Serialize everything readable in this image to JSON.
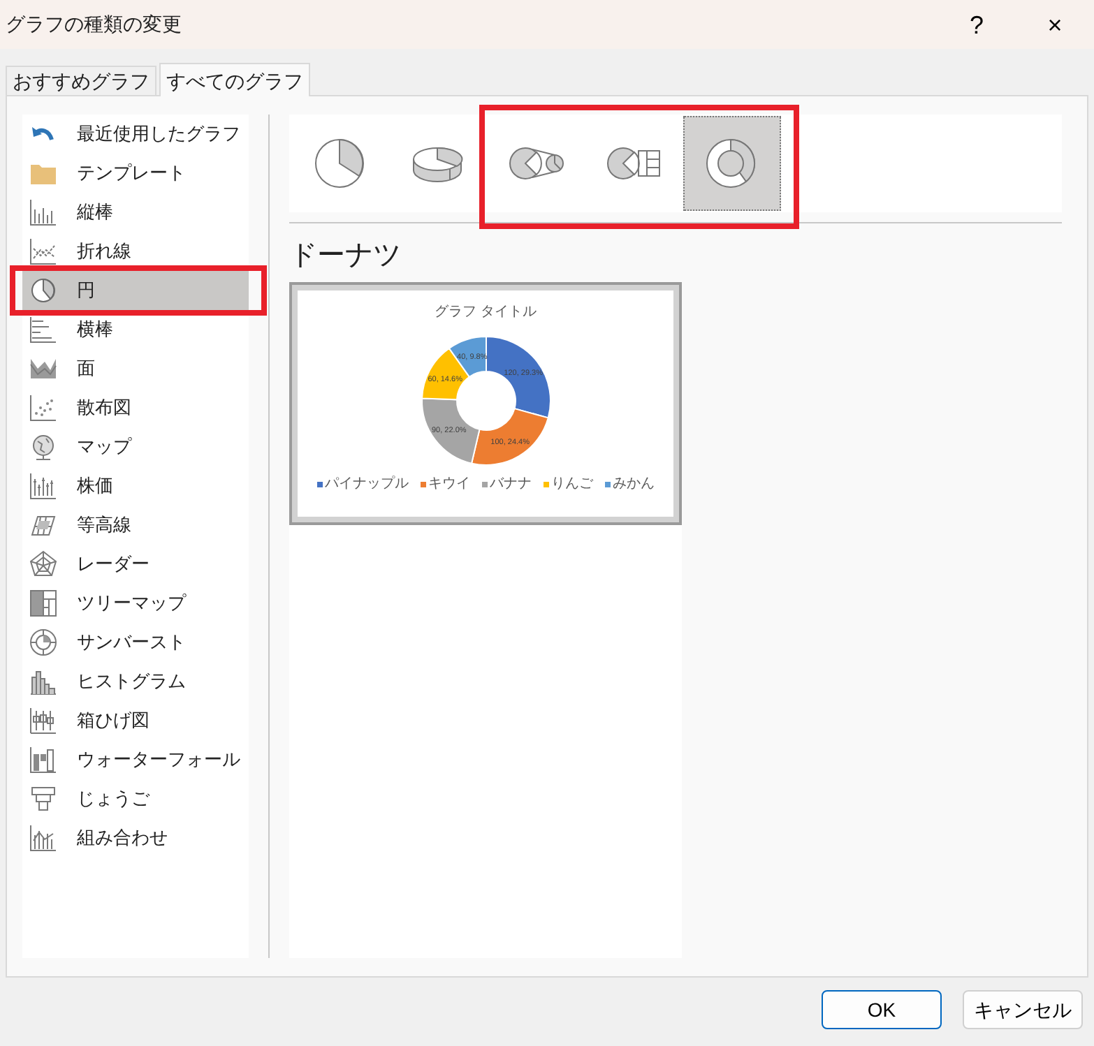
{
  "window": {
    "title": "グラフの種類の変更",
    "help": "?",
    "close": "×"
  },
  "tabs": [
    {
      "label": "おすすめグラフ",
      "selected": false
    },
    {
      "label": "すべてのグラフ",
      "selected": true
    }
  ],
  "sidebar": {
    "items": [
      {
        "label": "最近使用したグラフ",
        "selected": false,
        "highlighted": false
      },
      {
        "label": "テンプレート",
        "selected": false,
        "highlighted": false
      },
      {
        "label": "縦棒",
        "selected": false,
        "highlighted": false
      },
      {
        "label": "折れ線",
        "selected": false,
        "highlighted": false
      },
      {
        "label": "円",
        "selected": true,
        "highlighted": true
      },
      {
        "label": "横棒",
        "selected": false,
        "highlighted": false
      },
      {
        "label": "面",
        "selected": false,
        "highlighted": false
      },
      {
        "label": "散布図",
        "selected": false,
        "highlighted": false
      },
      {
        "label": "マップ",
        "selected": false,
        "highlighted": false
      },
      {
        "label": "株価",
        "selected": false,
        "highlighted": false
      },
      {
        "label": "等高線",
        "selected": false,
        "highlighted": false
      },
      {
        "label": "レーダー",
        "selected": false,
        "highlighted": false
      },
      {
        "label": "ツリーマップ",
        "selected": false,
        "highlighted": false
      },
      {
        "label": "サンバースト",
        "selected": false,
        "highlighted": false
      },
      {
        "label": "ヒストグラム",
        "selected": false,
        "highlighted": false
      },
      {
        "label": "箱ひげ図",
        "selected": false,
        "highlighted": false
      },
      {
        "label": "ウォーターフォール",
        "selected": false,
        "highlighted": false
      },
      {
        "label": "じょうご",
        "selected": false,
        "highlighted": false
      },
      {
        "label": "組み合わせ",
        "selected": false,
        "highlighted": false
      }
    ]
  },
  "subtypes": [
    {
      "kind": "pie",
      "selected": false,
      "highlighted": false
    },
    {
      "kind": "pie3d",
      "selected": false,
      "highlighted": false
    },
    {
      "kind": "pieofpie",
      "selected": false,
      "highlighted": true
    },
    {
      "kind": "barofpie",
      "selected": false,
      "highlighted": true
    },
    {
      "kind": "donut",
      "selected": true,
      "highlighted": true
    }
  ],
  "subtype_title": "ドーナツ",
  "preview": {
    "chart_data": {
      "type": "donut",
      "title": "グラフ タイトル",
      "categories": [
        "パイナップル",
        "キウイ",
        "バナナ",
        "りんご",
        "みかん"
      ],
      "colors": [
        "#4472c4",
        "#ed7d31",
        "#a5a5a5",
        "#ffc000",
        "#5b9bd5"
      ],
      "series": [
        {
          "values": [
            29.3,
            24.4,
            22.0,
            14.6,
            9.8
          ]
        }
      ],
      "legend": true,
      "value_labels": [
        "120, 29.3%",
        "100, 24.4%",
        "90, 22.0%",
        "60, 14.6%",
        "40, 9.8%"
      ]
    }
  },
  "buttons": [
    {
      "label": "OK",
      "kind": "primary"
    },
    {
      "label": "キャンセル",
      "kind": "secondary"
    }
  ]
}
